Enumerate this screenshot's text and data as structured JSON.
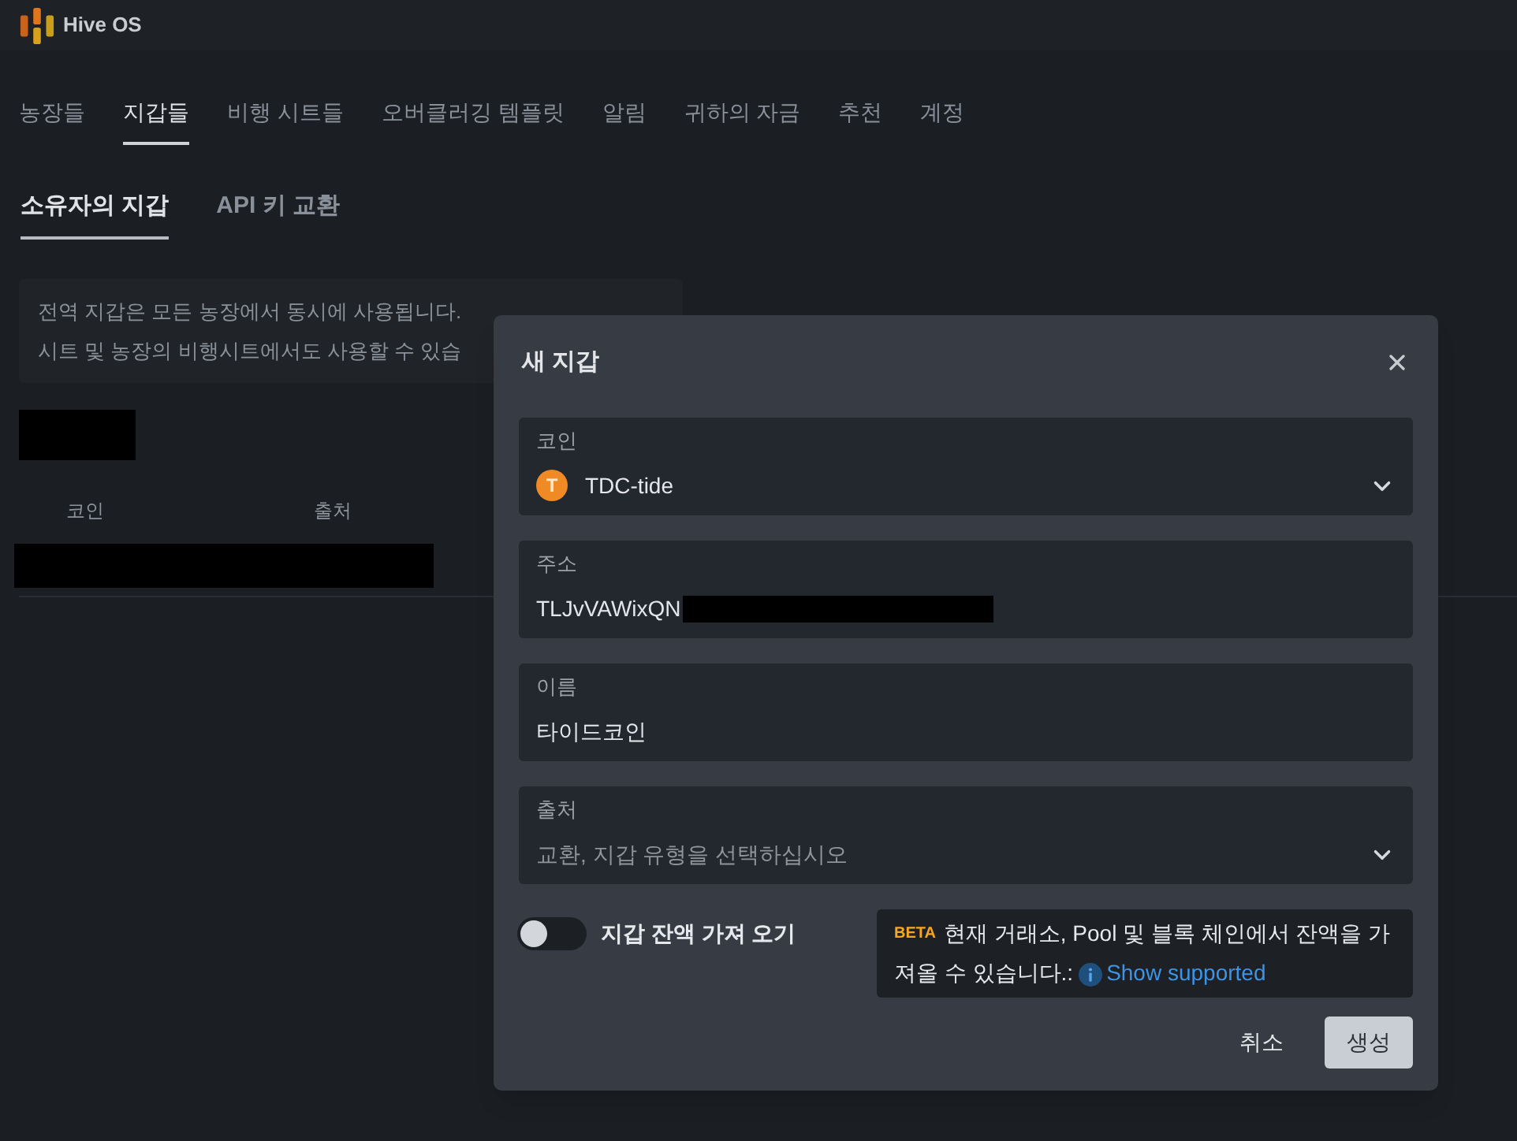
{
  "header": {
    "brand": "Hive OS"
  },
  "nav_tabs": [
    {
      "label": "농장들",
      "selected": false
    },
    {
      "label": "지갑들",
      "selected": true
    },
    {
      "label": "비행 시트들",
      "selected": false
    },
    {
      "label": "오버클러깅 템플릿",
      "selected": false
    },
    {
      "label": "알림",
      "selected": false
    },
    {
      "label": "귀하의 자금",
      "selected": false
    },
    {
      "label": "추천",
      "selected": false
    },
    {
      "label": "계정",
      "selected": false
    }
  ],
  "sub_tabs": [
    {
      "label": "소유자의 지갑",
      "selected": true
    },
    {
      "label": "API 키 교환",
      "selected": false
    }
  ],
  "info_lines": [
    "전역 지갑은 모든 농장에서 동시에 사용됩니다.",
    "시트 및 농장의 비행시트에서도 사용할 수 있습"
  ],
  "wallet_table": {
    "columns": [
      "코인",
      "출처"
    ]
  },
  "dialog": {
    "title": "새 지갑",
    "fields": [
      {
        "kind": "select",
        "label": "코인",
        "value": "TDC-tide",
        "icon_letter": "T"
      },
      {
        "kind": "input",
        "label": "주소",
        "value": "TLJvVAWixQN",
        "redacted": true
      },
      {
        "kind": "input",
        "label": "이름",
        "value": "타이드코인"
      },
      {
        "kind": "select",
        "label": "출처",
        "placeholder": "교환, 지갑 유형을 선택하십시오"
      }
    ],
    "balance_toggle": {
      "label": "지갑 잔액 가져 오기",
      "on": false
    },
    "beta_note": {
      "badge": "BETA",
      "text": "현재 거래소, Pool 및 블록 체인에서 잔액을 가져올 수 있습니다.:",
      "link": "Show supported"
    },
    "buttons": [
      {
        "label": "취소",
        "kind": "text"
      },
      {
        "label": "생성",
        "kind": "primary"
      }
    ]
  }
}
